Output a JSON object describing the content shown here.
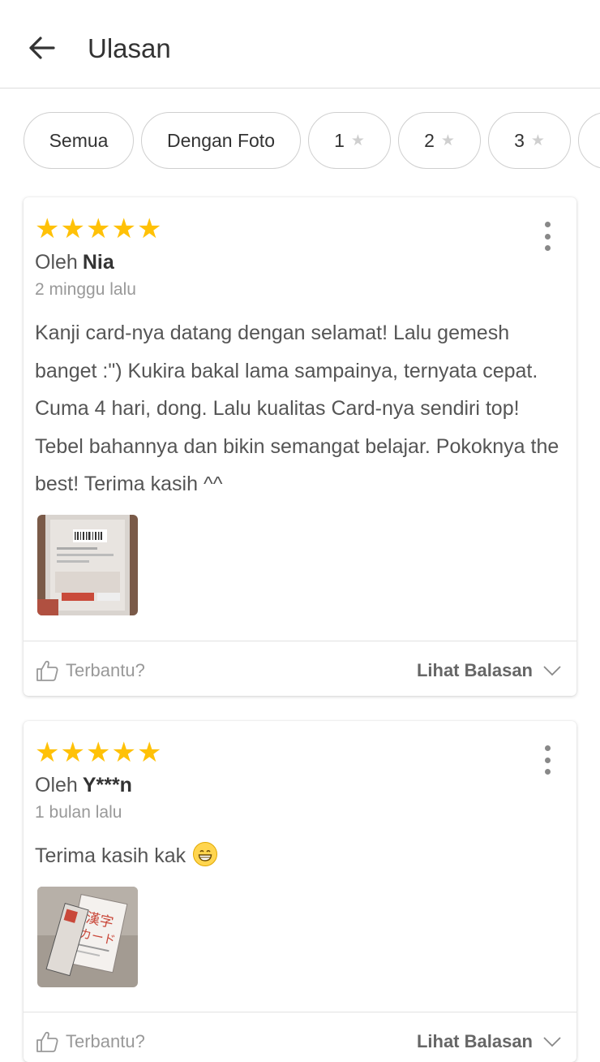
{
  "header": {
    "title": "Ulasan",
    "back_icon": "arrow-left-icon"
  },
  "filters": [
    {
      "label": "Semua"
    },
    {
      "label": "Dengan Foto"
    },
    {
      "label": "1",
      "icon": "star-icon"
    },
    {
      "label": "2",
      "icon": "star-icon"
    },
    {
      "label": "3",
      "icon": "star-icon"
    }
  ],
  "reviews": [
    {
      "rating": 5,
      "by_prefix": "Oleh",
      "author": "Nia",
      "time": "2 minggu lalu",
      "text": "Kanji card-nya datang dengan selamat! Lalu gemesh banget :\") Kukira bakal lama sampainya, ternyata cepat. Cuma 4 hari, dong. Lalu kualitas Card-nya sendiri top! Tebel bahannya dan bikin semangat belajar. Pokoknya the best! Terima kasih ^^",
      "helpful_label": "Terbantu?",
      "reply_label": "Lihat Balasan"
    },
    {
      "rating": 5,
      "by_prefix": "Oleh",
      "author": "Y***n",
      "time": "1 bulan lalu",
      "text": "Terima kasih kak",
      "helpful_label": "Terbantu?",
      "reply_label": "Lihat Balasan"
    }
  ],
  "colors": {
    "star_active": "#ffc107",
    "star_inactive": "#cfcfcf"
  }
}
